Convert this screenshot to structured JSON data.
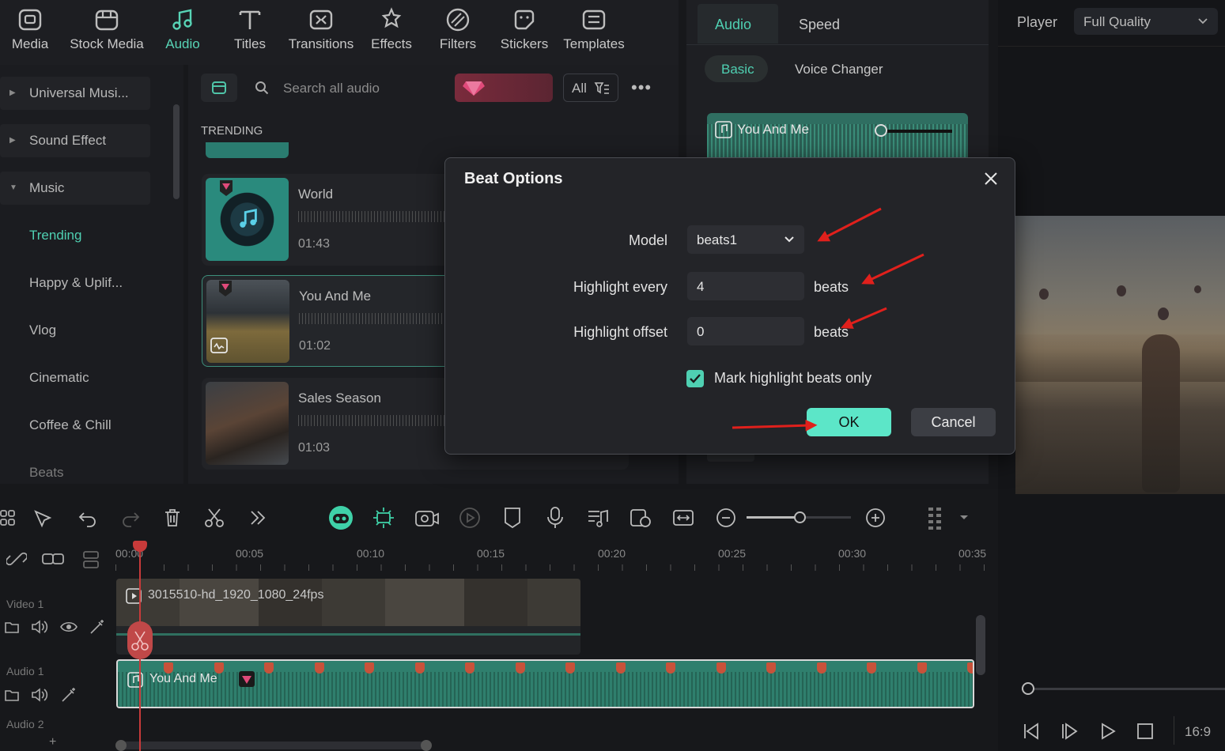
{
  "toolbar": {
    "items": [
      {
        "label": "Media",
        "icon": "media-icon"
      },
      {
        "label": "Stock Media",
        "icon": "stock-media-icon"
      },
      {
        "label": "Audio",
        "icon": "music-note-icon"
      },
      {
        "label": "Titles",
        "icon": "titles-icon"
      },
      {
        "label": "Transitions",
        "icon": "transitions-icon"
      },
      {
        "label": "Effects",
        "icon": "effects-icon"
      },
      {
        "label": "Filters",
        "icon": "filters-icon"
      },
      {
        "label": "Stickers",
        "icon": "stickers-icon"
      },
      {
        "label": "Templates",
        "icon": "templates-icon"
      }
    ],
    "active": "Audio",
    "accent": "#58d4b6"
  },
  "sidebar": {
    "items": [
      {
        "label": "Universal Musi..."
      },
      {
        "label": "Sound Effect"
      },
      {
        "label": "Music"
      },
      {
        "label": "Trending"
      },
      {
        "label": "Happy & Uplif..."
      },
      {
        "label": "Vlog"
      },
      {
        "label": "Cinematic"
      },
      {
        "label": "Coffee & Chill"
      },
      {
        "label": "Beats"
      }
    ]
  },
  "library": {
    "search_placeholder": "Search all audio",
    "filter_label": "All",
    "section": "TRENDING",
    "tracks": [
      {
        "title": "World",
        "duration": "01:43"
      },
      {
        "title": "You And Me",
        "duration": "01:02"
      },
      {
        "title": "Sales Season",
        "duration": "01:03"
      }
    ]
  },
  "properties": {
    "tabs": [
      "Audio",
      "Speed"
    ],
    "subtabs": [
      "Basic",
      "Voice Changer"
    ],
    "clip_name": "You And Me"
  },
  "player": {
    "label": "Player",
    "quality": "Full Quality",
    "aspect": "16:9"
  },
  "timeline": {
    "ruler": [
      "00:00",
      "00:05",
      "00:10",
      "00:15",
      "00:20",
      "00:25",
      "00:30",
      "00:35"
    ],
    "tracks": {
      "video1": "Video 1",
      "audio1": "Audio 1",
      "audio2": "Audio 2"
    },
    "video_clip": "3015510-hd_1920_1080_24fps",
    "audio_clip": "You And Me"
  },
  "dialog": {
    "title": "Beat Options",
    "model_label": "Model",
    "model_value": "beats1",
    "highlight_every_label": "Highlight every",
    "highlight_every_value": "4",
    "highlight_offset_label": "Highlight offset",
    "highlight_offset_value": "0",
    "unit": "beats",
    "checkbox_label": "Mark highlight beats only",
    "checkbox_checked": true,
    "ok": "OK",
    "cancel": "Cancel",
    "ok_color": "#5ce6c8",
    "arrow_color": "#e0201c"
  }
}
